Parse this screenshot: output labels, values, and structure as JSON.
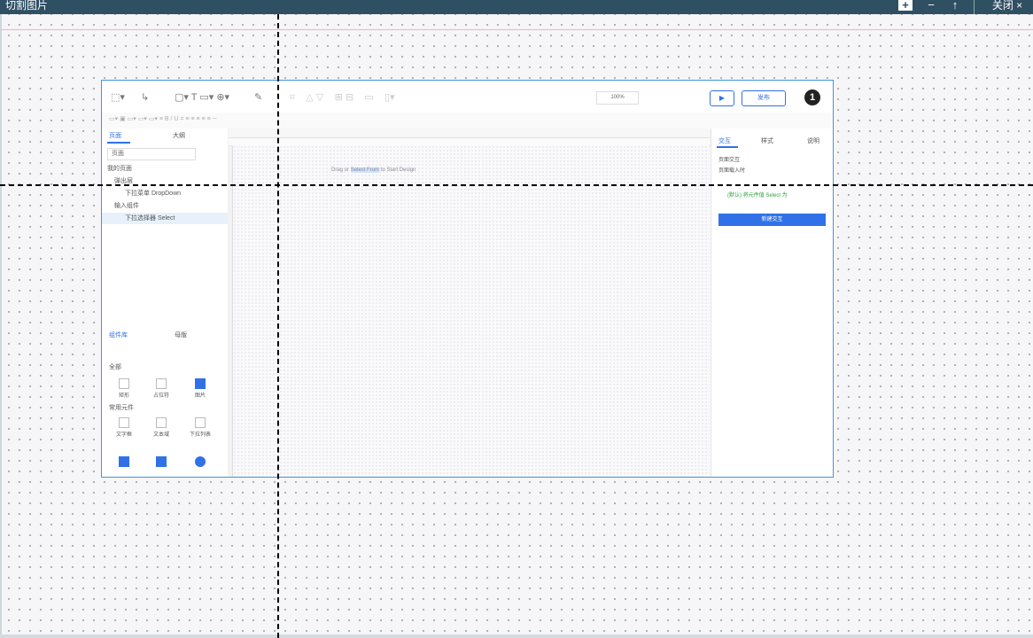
{
  "window": {
    "title": "切割图片",
    "controls": {
      "zoom_in": "+",
      "zoom_out": "−",
      "rotate": "↑",
      "close": "关闭 ×"
    }
  },
  "colors": {
    "titlebar": "#2f4f63",
    "accent": "#3071e8",
    "frame": "#3d97e2"
  },
  "screenshot": {
    "zoom": "100%",
    "badge": "1",
    "publish_label": "发布",
    "left_tabs": [
      "页面",
      "大纲"
    ],
    "search_placeholder": "页面",
    "tree": [
      "我的页面",
      "弹出层",
      "下拉菜单 DropDown",
      "输入组件",
      "下拉选择器 Select"
    ],
    "comp_tabs": [
      "组件库",
      "母版"
    ],
    "comp_filter": "全部",
    "comp_items_row1": [
      "矩形",
      "占位符",
      "图片"
    ],
    "comp_group": "常用元件",
    "comp_items_row2": [
      "文字框",
      "文本域",
      "下拉列表"
    ],
    "right_tabs": [
      "交互",
      "样式",
      "说明"
    ],
    "right_texts": [
      "页面交互",
      "页面载入时",
      "(默认) 将元件值 Select 为"
    ],
    "new_interaction": "新建交互",
    "canvas_hint_pre": "Drag or ",
    "canvas_hint_highlight": "Select From",
    "canvas_hint_post": " to Start Design"
  }
}
